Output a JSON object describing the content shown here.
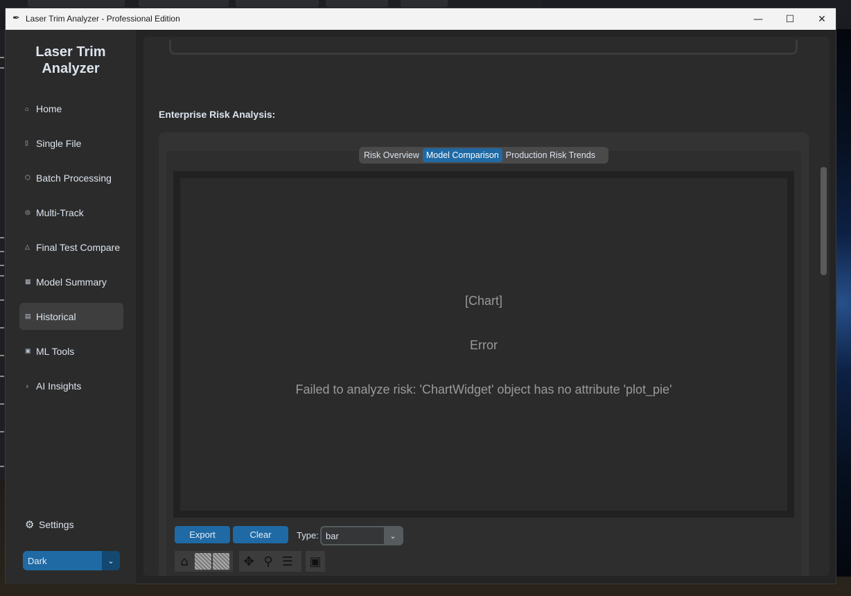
{
  "window": {
    "title": "Laser Trim Analyzer - Professional Edition",
    "minimize_glyph": "—",
    "maximize_glyph": "☐",
    "close_glyph": "✕",
    "app_icon": "feather-icon"
  },
  "sidebar": {
    "brand_line1": "Laser Trim",
    "brand_line2": "Analyzer",
    "items": [
      {
        "label": "Home",
        "icon": "house-icon",
        "glyph": "⌂"
      },
      {
        "label": "Single File",
        "icon": "document-icon",
        "glyph": "▯"
      },
      {
        "label": "Batch Processing",
        "icon": "box-icon",
        "glyph": "⬡"
      },
      {
        "label": "Multi-Track",
        "icon": "target-icon",
        "glyph": "◎"
      },
      {
        "label": "Final Test Compare",
        "icon": "flask-icon",
        "glyph": "△"
      },
      {
        "label": "Model Summary",
        "icon": "chart-icon",
        "glyph": "▦"
      },
      {
        "label": "Historical",
        "icon": "scroll-icon",
        "glyph": "▤"
      },
      {
        "label": "ML Tools",
        "icon": "robot-icon",
        "glyph": "▣"
      },
      {
        "label": "AI Insights",
        "icon": "bulb-icon",
        "glyph": "♁"
      }
    ],
    "active_item": "Historical",
    "settings_label": "Settings",
    "settings_glyph": "⚙",
    "theme_value": "Dark",
    "dropdown_glyph": "⌄"
  },
  "main": {
    "section_title": "Enterprise Risk Analysis:",
    "tabs": [
      {
        "label": "Risk Overview",
        "active": false
      },
      {
        "label": "Model Comparison",
        "active": true
      },
      {
        "label": "Production Risk Trends",
        "active": false
      }
    ],
    "chart_placeholder": "[Chart]",
    "error_title": "Error",
    "error_message": "Failed to analyze risk: 'ChartWidget' object has no attribute 'plot_pie'",
    "export_label": "Export",
    "clear_label": "Clear",
    "type_label": "Type:",
    "type_value": "bar"
  },
  "colors": {
    "accent": "#1f6aa5",
    "sidebar_bg": "#2b2b2b",
    "window_bg": "#242424"
  }
}
